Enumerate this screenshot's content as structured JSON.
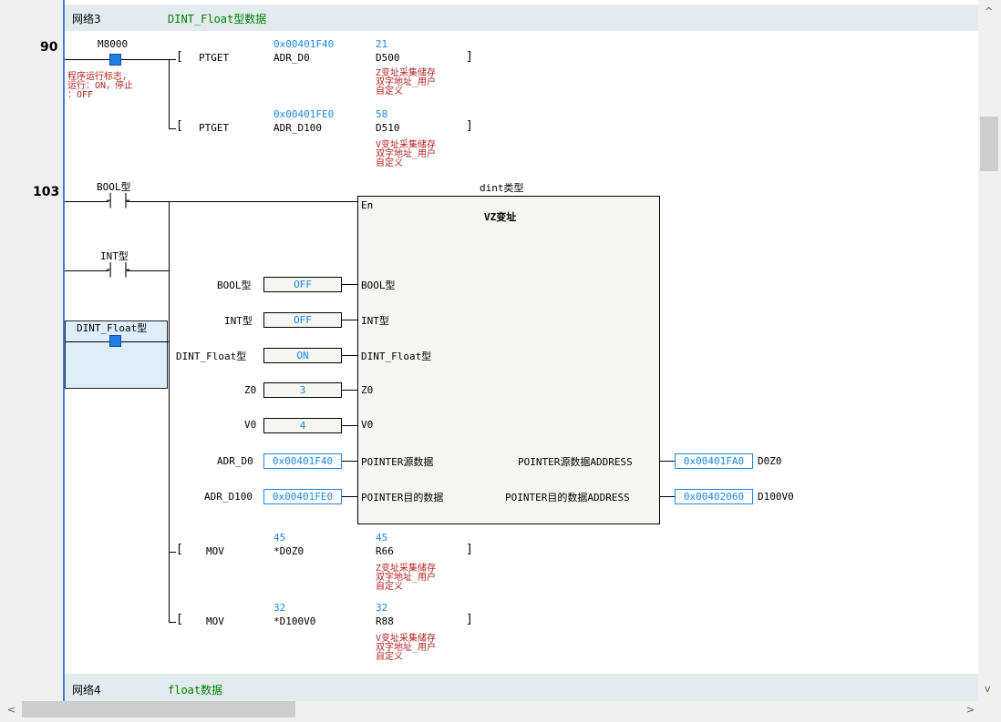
{
  "net3": {
    "label": "网络3",
    "comment": "DINT_Float型数据"
  },
  "net4": {
    "label": "网络4",
    "comment": "float数据"
  },
  "rungs": {
    "r90": "90",
    "r103": "103"
  },
  "m8000": {
    "name": "M8000",
    "comment": "程序运行标志，\n运行：ON，停止\n：OFF"
  },
  "ptget1": {
    "op": "PTGET",
    "arg1": "ADR_D0",
    "arg1_val": "0x00401F40",
    "arg2": "D500",
    "arg2_val": "21",
    "comment": "Z变址采集储存\n双字地址_用户\n自定义"
  },
  "ptget2": {
    "op": "PTGET",
    "arg1": "ADR_D100",
    "arg1_val": "0x00401FE0",
    "arg2": "D510",
    "arg2_val": "58",
    "comment": "V变址采集储存\n双字地址_用户\n自定义"
  },
  "contacts": {
    "bool": "BOOL型",
    "int": "INT型",
    "dint": "DINT_Float型"
  },
  "fb": {
    "type": "dint类型",
    "en": "En",
    "title": "VZ变址",
    "inputs": [
      {
        "ext": "BOOL型",
        "val": "OFF",
        "pin": "BOOL型"
      },
      {
        "ext": "INT型",
        "val": "OFF",
        "pin": "INT型"
      },
      {
        "ext": "DINT_Float型",
        "val": "ON",
        "pin": "DINT_Float型"
      },
      {
        "ext": "Z0",
        "val": "3",
        "pin": "Z0"
      },
      {
        "ext": "V0",
        "val": "4",
        "pin": "V0"
      },
      {
        "ext": "ADR_D0",
        "val": "0x00401F40",
        "pin": "POINTER源数据"
      },
      {
        "ext": "ADR_D100",
        "val": "0x00401FE0",
        "pin": "POINTER目的数据"
      }
    ],
    "outputs": [
      {
        "pin": "POINTER源数据ADDRESS",
        "val": "0x00401FA0",
        "ext": "D0Z0"
      },
      {
        "pin": "POINTER目的数据ADDRESS",
        "val": "0x00402060",
        "ext": "D100V0"
      }
    ]
  },
  "mov1": {
    "op": "MOV",
    "arg1": "*D0Z0",
    "arg1_val": "45",
    "arg2": "R66",
    "arg2_val": "45",
    "comment": "Z变址采集储存\n双字地址_用户\n自定义"
  },
  "mov2": {
    "op": "MOV",
    "arg1": "*D100V0",
    "arg1_val": "32",
    "arg2": "R88",
    "arg2_val": "32",
    "comment": "V变址采集储存\n双字地址_用户\n自定义"
  },
  "scroll": {
    "up": "^",
    "down": "v",
    "left": "<",
    "right": ">"
  }
}
